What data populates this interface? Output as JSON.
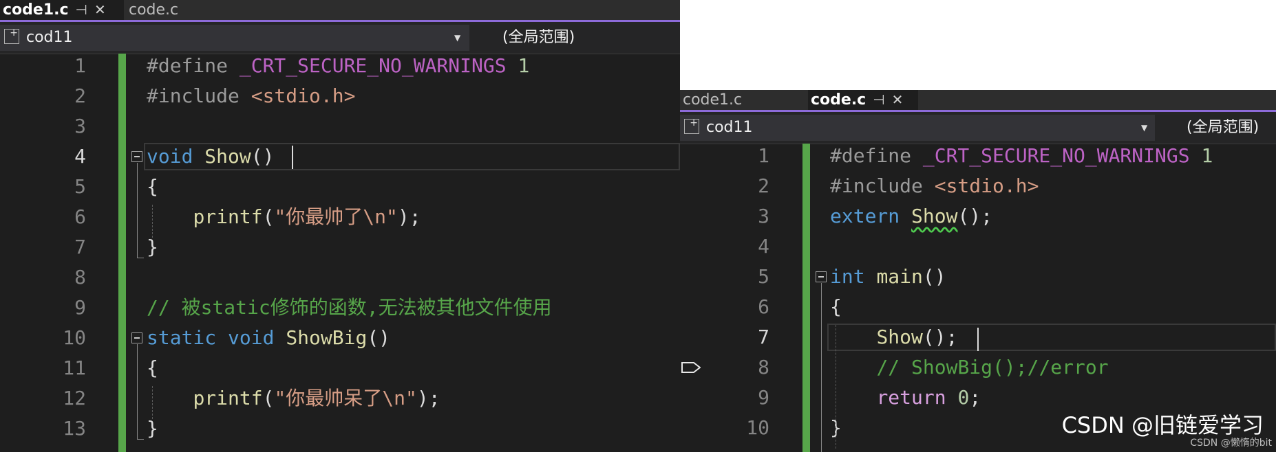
{
  "left": {
    "tabs": [
      {
        "label": "code1.c",
        "active": true
      },
      {
        "label": "code.c",
        "active": false
      }
    ],
    "nav": {
      "project": "cod11",
      "scope": "(全局范围)"
    },
    "current_line": "4",
    "lines": [
      {
        "n": "1",
        "parts": [
          [
            "#define ",
            "pp"
          ],
          [
            "_CRT_SECURE_NO_WARNINGS",
            "mac"
          ],
          [
            " 1",
            "num"
          ]
        ]
      },
      {
        "n": "2",
        "parts": [
          [
            "#include ",
            "pp"
          ],
          [
            "<stdio.h>",
            "str"
          ]
        ]
      },
      {
        "n": "3",
        "parts": []
      },
      {
        "n": "4",
        "parts": [
          [
            "void",
            "kw"
          ],
          [
            " ",
            "pl"
          ],
          [
            "Show",
            "fn"
          ],
          [
            "()",
            "pl"
          ]
        ]
      },
      {
        "n": "5",
        "parts": [
          [
            "{",
            "pl"
          ]
        ]
      },
      {
        "n": "6",
        "parts": [
          [
            "    ",
            "pl"
          ],
          [
            "printf",
            "fn"
          ],
          [
            "(",
            "pl"
          ],
          [
            "\"你最帅了\\n\"",
            "str"
          ],
          [
            ");",
            "pl"
          ]
        ]
      },
      {
        "n": "7",
        "parts": [
          [
            "}",
            "pl"
          ]
        ]
      },
      {
        "n": "8",
        "parts": []
      },
      {
        "n": "9",
        "parts": [
          [
            "// 被static修饰的函数,无法被其他文件使用",
            "cm"
          ]
        ]
      },
      {
        "n": "10",
        "parts": [
          [
            "static",
            "kw"
          ],
          [
            " ",
            "pl"
          ],
          [
            "void",
            "kw"
          ],
          [
            " ",
            "pl"
          ],
          [
            "ShowBig",
            "fn"
          ],
          [
            "()",
            "pl"
          ]
        ]
      },
      {
        "n": "11",
        "parts": [
          [
            "{",
            "pl"
          ]
        ]
      },
      {
        "n": "12",
        "parts": [
          [
            "    ",
            "pl"
          ],
          [
            "printf",
            "fn"
          ],
          [
            "(",
            "pl"
          ],
          [
            "\"你最帅呆了\\n\"",
            "str"
          ],
          [
            ");",
            "pl"
          ]
        ]
      },
      {
        "n": "13",
        "parts": [
          [
            "}",
            "pl"
          ]
        ]
      }
    ]
  },
  "right": {
    "tabs": [
      {
        "label": "code1.c",
        "active": false
      },
      {
        "label": "code.c",
        "active": true
      }
    ],
    "nav": {
      "project": "cod11",
      "scope": "(全局范围)"
    },
    "current_line": "7",
    "lines": [
      {
        "n": "1",
        "parts": [
          [
            "#define ",
            "pp"
          ],
          [
            "_CRT_SECURE_NO_WARNINGS",
            "mac"
          ],
          [
            " 1",
            "num"
          ]
        ]
      },
      {
        "n": "2",
        "parts": [
          [
            "#include ",
            "pp"
          ],
          [
            "<stdio.h>",
            "str"
          ]
        ]
      },
      {
        "n": "3",
        "parts": [
          [
            "extern",
            "kw"
          ],
          [
            " ",
            "pl"
          ],
          [
            "Show",
            "fn squig"
          ],
          [
            "();",
            "pl"
          ]
        ]
      },
      {
        "n": "4",
        "parts": []
      },
      {
        "n": "5",
        "parts": [
          [
            "int",
            "kw"
          ],
          [
            " ",
            "pl"
          ],
          [
            "main",
            "fn"
          ],
          [
            "()",
            "pl"
          ]
        ]
      },
      {
        "n": "6",
        "parts": [
          [
            "{",
            "pl"
          ]
        ]
      },
      {
        "n": "7",
        "parts": [
          [
            "    ",
            "pl"
          ],
          [
            "Show",
            "fn"
          ],
          [
            "();",
            "pl"
          ]
        ]
      },
      {
        "n": "8",
        "parts": [
          [
            "    ",
            "pl"
          ],
          [
            "// ShowBig();//error",
            "cm"
          ]
        ]
      },
      {
        "n": "9",
        "parts": [
          [
            "    ",
            "pl"
          ],
          [
            "return",
            "ctl"
          ],
          [
            " ",
            "pl"
          ],
          [
            "0",
            "num"
          ],
          [
            ";",
            "pl"
          ]
        ]
      },
      {
        "n": "10",
        "parts": [
          [
            "}",
            "pl"
          ]
        ]
      }
    ]
  },
  "watermark": "CSDN @旧链爱学习",
  "watermark_small": "CSDN @懒惰的bit"
}
